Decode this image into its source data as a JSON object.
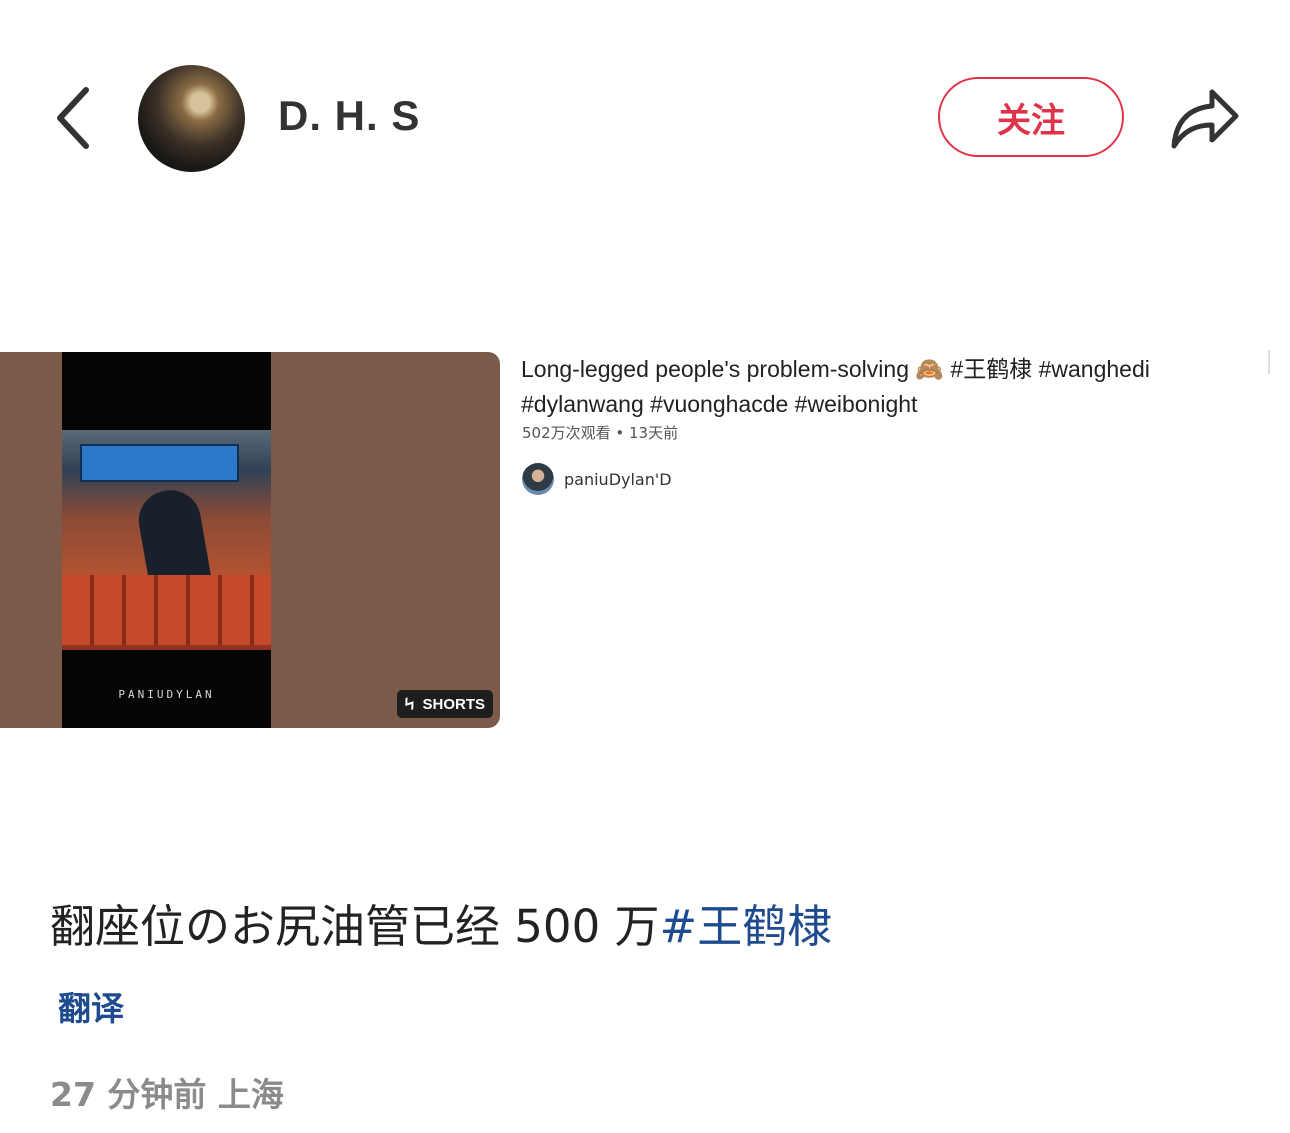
{
  "header": {
    "username": "D. H. S",
    "follow_label": "关注"
  },
  "embed": {
    "title": "Long-legged people's problem-solving 🙈 #王鹤棣 #wanghedi #dylanwang #vuonghacde #weibonight",
    "meta": "502万次观看 • 13天前",
    "channel_name": "paniuDylan'D",
    "watermark": "PANIUDYLAN",
    "shorts_label": "SHORTS"
  },
  "post": {
    "text": "翻座位のお尻油管已经 500 万",
    "hashtag": "#王鹤棣",
    "translate_label": "翻译",
    "timestamp": "27 分钟前 上海"
  },
  "colors": {
    "accent_red": "#e0334a",
    "link_blue": "#1e4b8f",
    "muted_gray": "#8b8b8b"
  },
  "icons": [
    "back-icon",
    "share-icon",
    "shorts-icon"
  ]
}
